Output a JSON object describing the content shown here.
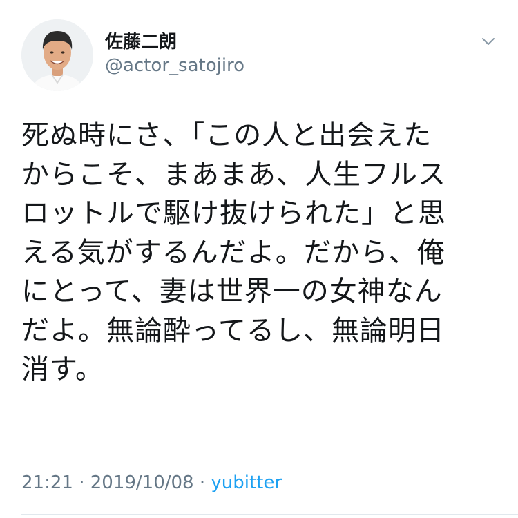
{
  "tweet": {
    "author": {
      "display_name": "佐藤二朗",
      "handle": "@actor_satojiro"
    },
    "text": "死ぬ時にさ、「この人と出会えた\nからこそ、まあまあ、人生フルス\nロットルで駆け抜けられた」と思\nえる気がするんだよ。だから、俺\nにとって、妻は世界一の女神なん\nだよ。無論酔ってるし、無論明日\n消す。",
    "time": "21:21",
    "date": "2019/10/08",
    "separator": "·",
    "source": "yubitter"
  },
  "icons": {
    "menu": "chevron-down-icon"
  },
  "colors": {
    "text": "#14171a",
    "secondary": "#657786",
    "link": "#1da1f2",
    "divider": "#e1e8ed"
  }
}
